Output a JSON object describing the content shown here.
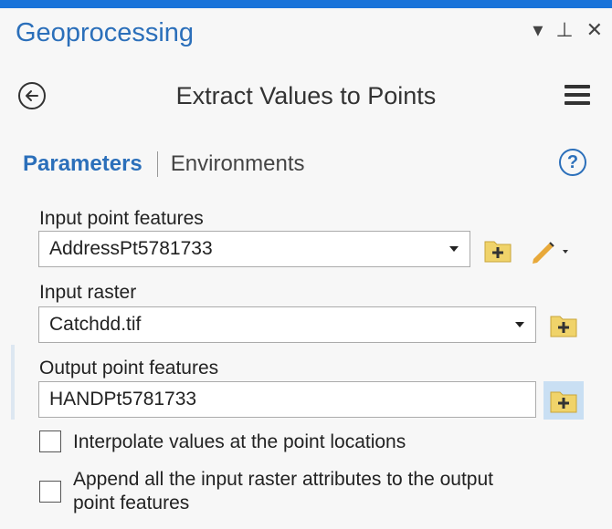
{
  "pane": {
    "title": "Geoprocessing",
    "controls": {
      "menu": "▾",
      "pin": "⊥",
      "close": "✕"
    }
  },
  "tool": {
    "title": "Extract Values to Points"
  },
  "tabs": {
    "active": "Parameters",
    "inactive": "Environments",
    "help": "?"
  },
  "params": {
    "input_points": {
      "label": "Input point features",
      "value": "AddressPt5781733"
    },
    "input_raster": {
      "label": "Input raster",
      "value": "Catchdd.tif"
    },
    "output_points": {
      "label": "Output point features",
      "value": "HANDPt5781733"
    }
  },
  "options": {
    "interpolate": {
      "label": "Interpolate values at the point locations",
      "checked": false
    },
    "append_line1": "Append all the input raster attributes to the output",
    "append_line2": "point features"
  },
  "colors": {
    "accent": "#1a73d9",
    "link": "#2b6fba",
    "folder": "#f0d36a"
  },
  "icons": [
    "back-icon",
    "hamburger-menu-icon",
    "help-icon",
    "dropdown-arrow-icon",
    "add-folder-icon",
    "pencil-icon"
  ]
}
